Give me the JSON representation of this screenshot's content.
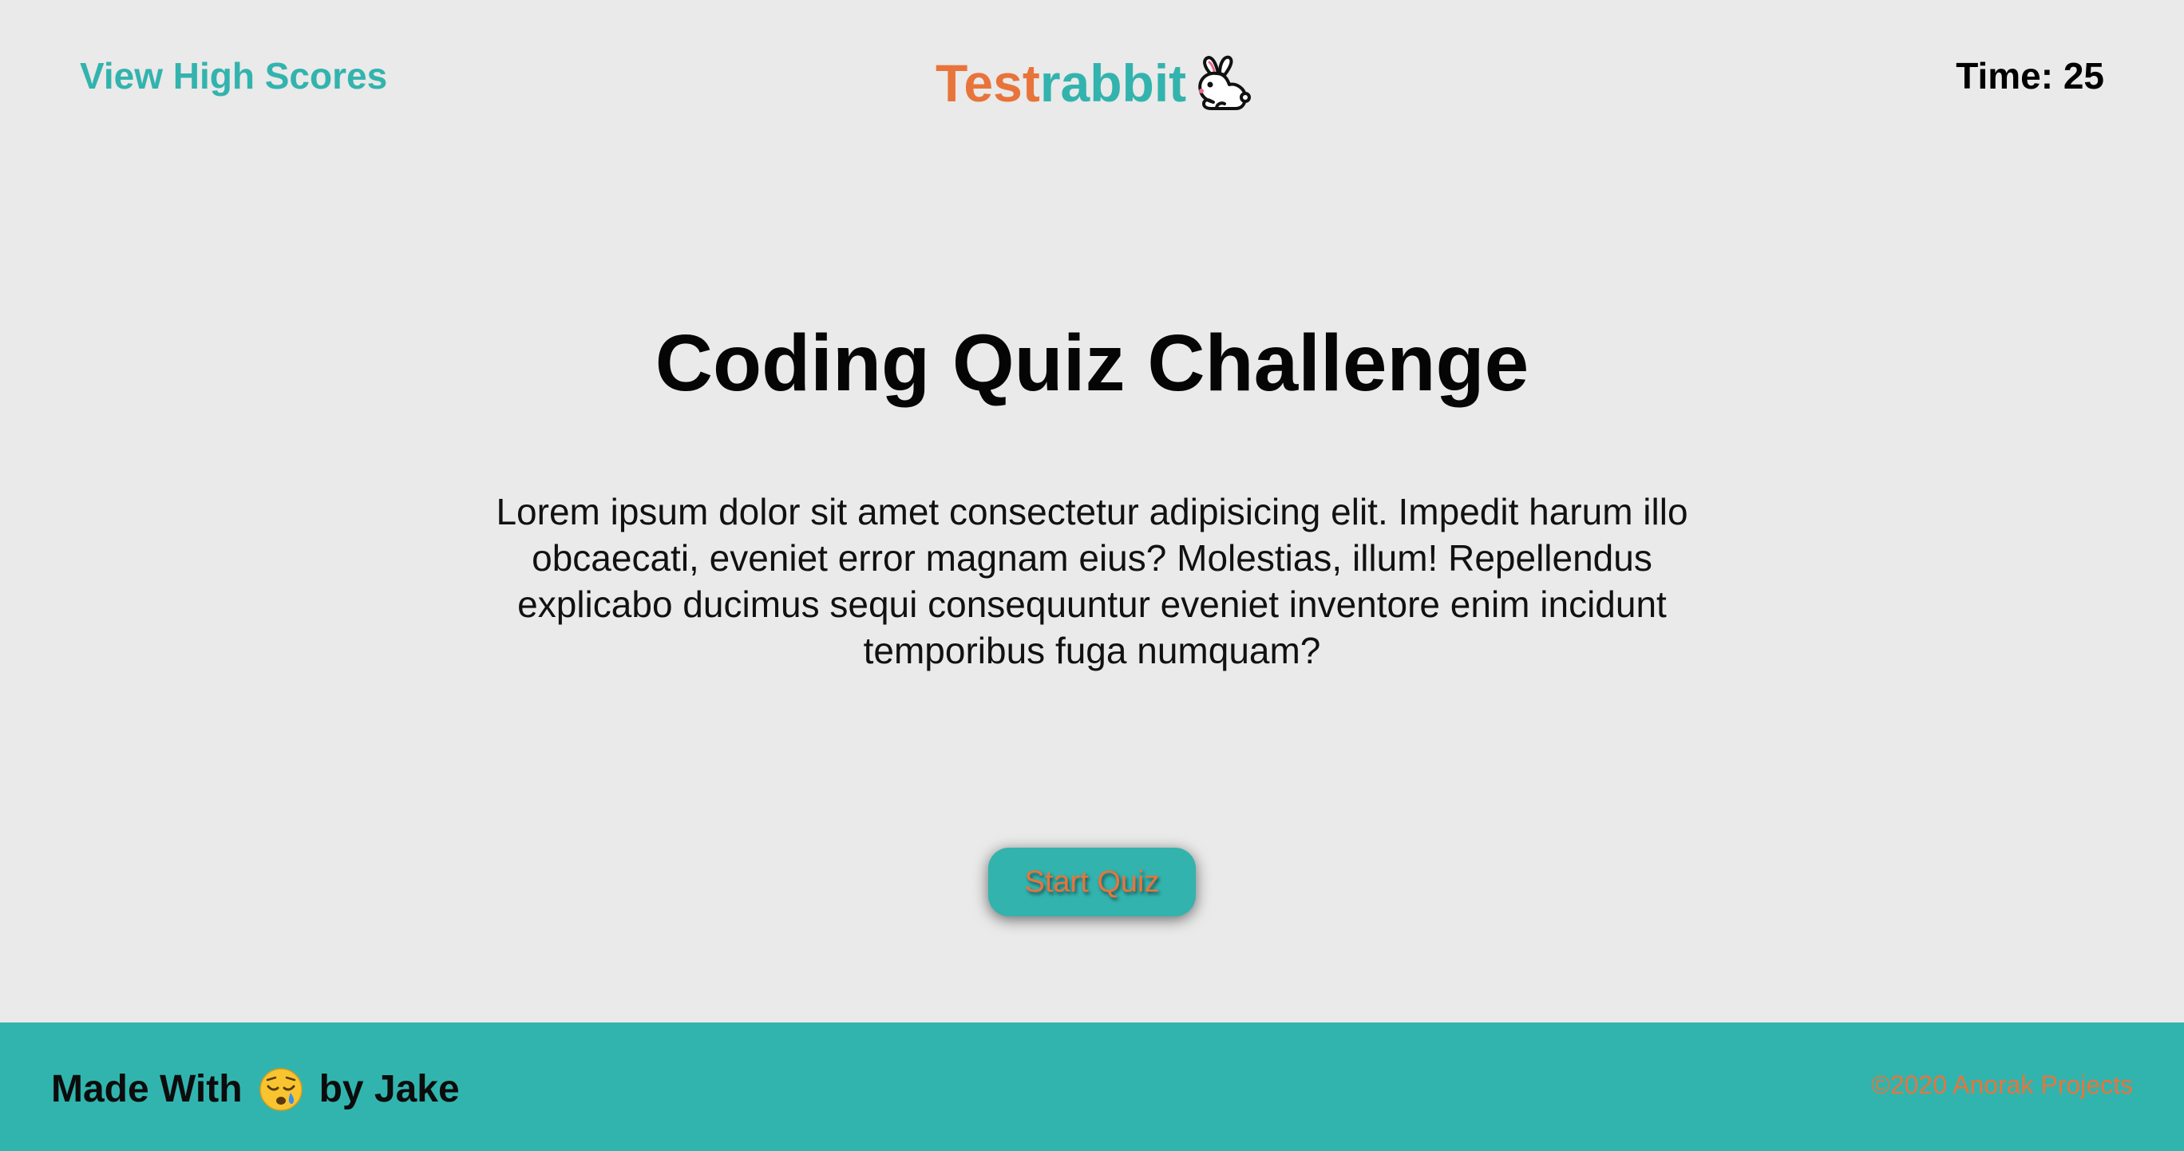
{
  "header": {
    "high_scores_label": "View High Scores",
    "brand_part1": "Test",
    "brand_part2": "rabbit",
    "brand_icon": "rabbit-icon",
    "timer_text": "Time: 25"
  },
  "main": {
    "title": "Coding Quiz Challenge",
    "intro": "Lorem ipsum dolor sit amet consectetur adipisicing elit. Impedit harum illo obcaecati, eveniet error magnam eius? Molestias, illum! Repellendus explicabo ducimus sequi consequuntur eveniet inventore enim incidunt temporibus fuga numquam?",
    "start_button_label": "Start Quiz"
  },
  "footer": {
    "made_with_prefix": "Made With",
    "emoji_icon": "sad-relieved-face-icon",
    "made_with_suffix": "by Jake",
    "copyright": "©2020 Anorak Projects"
  },
  "colors": {
    "accent_teal": "#33b3ae",
    "accent_orange": "#e8743b",
    "background": "#e9eae9",
    "footer_background": "#31b4ae"
  }
}
